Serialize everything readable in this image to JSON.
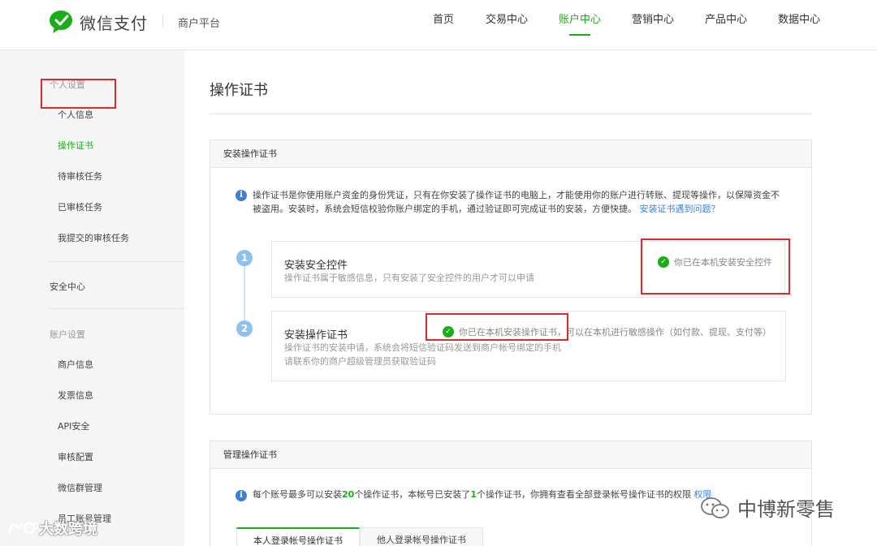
{
  "header": {
    "brand": "微信支付",
    "platform": "商户平台",
    "nav": [
      {
        "label": "首页",
        "active": false
      },
      {
        "label": "交易中心",
        "active": false
      },
      {
        "label": "账户中心",
        "active": true
      },
      {
        "label": "营销中心",
        "active": false
      },
      {
        "label": "产品中心",
        "active": false
      },
      {
        "label": "数据中心",
        "active": false
      }
    ]
  },
  "sidebar": {
    "group_personal": "个人设置",
    "personal_items": [
      "个人信息",
      "操作证书",
      "待审核任务",
      "已审核任务",
      "我提交的审核任务"
    ],
    "security": "安全中心",
    "group_account": "账户设置",
    "account_items": [
      "商户信息",
      "发票信息",
      "API安全",
      "审核配置",
      "微信群管理",
      "员工账号管理"
    ]
  },
  "page": {
    "title": "操作证书"
  },
  "install_panel": {
    "title": "安装操作证书",
    "note_line1": "操作证书是你使用账户资金的身份凭证，只有在你安装了操作证书的电脑上，才能使用你的账户进行转账、提现等操作，以保障资金不",
    "note_line2": "被盗用。安装时，系统会短信校验你账户绑定的手机，通过验证即可完成证书的安装，方便快捷。",
    "note_link": "安装证书遇到问题？",
    "step1": {
      "num": "1",
      "title": "安装安全控件",
      "desc": "操作证书属于敏感信息，只有安装了安全控件的用户才可以申请",
      "status": "你已在本机安装安全控件"
    },
    "step2": {
      "num": "2",
      "title": "安装操作证书",
      "desc_line1": "操作证书的安装申请，系统会将短信验证码发送到商户帐号绑定的手机",
      "desc_line2": "请联系你的商户超级管理员获取验证码",
      "status": "你已在本机安装操作证书，可以在本机进行敏感操作（如付款、提现、支付等）"
    }
  },
  "manage_panel": {
    "title": "管理操作证书",
    "note_a": "每个账号最多可以安装",
    "note_max": "20",
    "note_b": "个操作证书，本帐号已安装了",
    "note_count": "1",
    "note_c": "个操作证书，你拥有查看全部登录帐号操作证书的权限",
    "note_link": "权限",
    "tabs": [
      "本人登录帐号操作证书",
      "他人登录帐号操作证书"
    ]
  },
  "watermarks": {
    "left": "大数跨境",
    "right": "中博新零售"
  },
  "colors": {
    "accent": "#1aad19",
    "highlight": "#e02a2a",
    "link": "#3c7fd8"
  }
}
